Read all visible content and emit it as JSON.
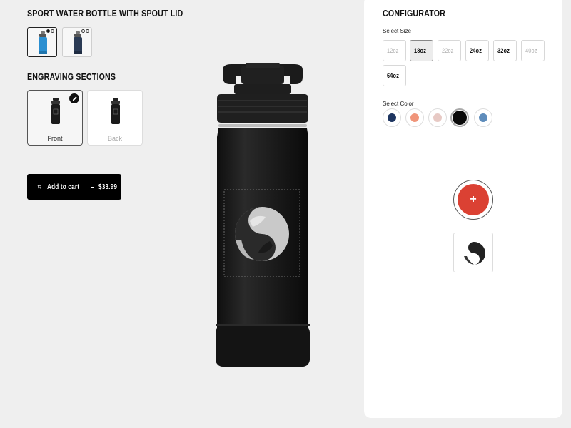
{
  "product": {
    "title": "SPORT WATER BOTTLE WITH SPOUT LID",
    "thumbnails": [
      {
        "name": "blue bottle",
        "selected": true
      },
      {
        "name": "navy bottle",
        "selected": false
      }
    ]
  },
  "engraving": {
    "title": "ENGRAVING SECTIONS",
    "sections": [
      {
        "label": "Front",
        "selected": true
      },
      {
        "label": "Back",
        "selected": false
      }
    ]
  },
  "cart": {
    "label": "Add to cart",
    "price": "$33.99"
  },
  "configurator": {
    "title": "CONFIGURATOR",
    "size_label": "Select Size",
    "sizes": [
      {
        "label": "12oz",
        "state": "disabled"
      },
      {
        "label": "18oz",
        "state": "selected"
      },
      {
        "label": "22oz",
        "state": "disabled"
      },
      {
        "label": "24oz",
        "state": "enabled"
      },
      {
        "label": "32oz",
        "state": "enabled"
      },
      {
        "label": "40oz",
        "state": "disabled"
      },
      {
        "label": "64oz",
        "state": "enabled"
      }
    ],
    "color_label": "Select Color",
    "colors": [
      {
        "name": "navy",
        "hex": "#1e3560",
        "selected": false
      },
      {
        "name": "coral",
        "hex": "#f0957a",
        "selected": false
      },
      {
        "name": "blush",
        "hex": "#e7c9c4",
        "selected": false
      },
      {
        "name": "black",
        "hex": "#0a0a0a",
        "selected": true
      },
      {
        "name": "slate blue",
        "hex": "#5e8cbb",
        "selected": false
      }
    ],
    "add_design_symbol": "+"
  },
  "theme": {
    "accent": "#db4133",
    "bottle_color": "#1a1a1a"
  }
}
